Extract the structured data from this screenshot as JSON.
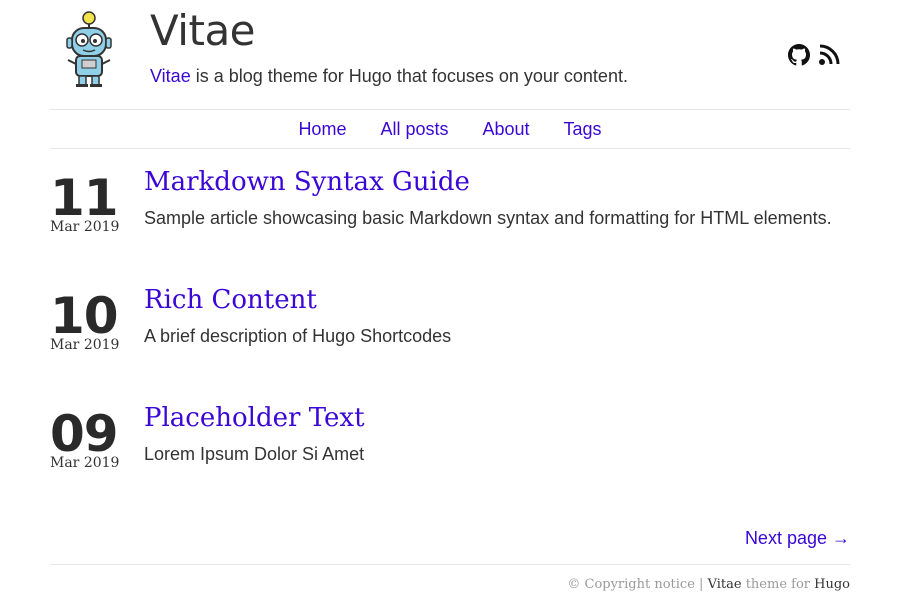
{
  "site": {
    "title": "Vitae",
    "tagline_link": "Vitae",
    "tagline_rest": " is a blog theme for Hugo that focuses on your content."
  },
  "social": [
    {
      "icon": "github-icon"
    },
    {
      "icon": "rss-icon"
    }
  ],
  "nav": [
    {
      "label": "Home"
    },
    {
      "label": "All posts"
    },
    {
      "label": "About"
    },
    {
      "label": "Tags"
    }
  ],
  "posts": [
    {
      "day": "11",
      "month": "Mar 2019",
      "title": "Markdown Syntax Guide",
      "description": "Sample article showcasing basic Markdown syntax and formatting for HTML elements."
    },
    {
      "day": "10",
      "month": "Mar 2019",
      "title": "Rich Content",
      "description": "A brief description of Hugo Shortcodes"
    },
    {
      "day": "09",
      "month": "Mar 2019",
      "title": "Placeholder Text",
      "description": "Lorem Ipsum Dolor Si Amet"
    }
  ],
  "pager": {
    "next_label": "Next page →"
  },
  "footer": {
    "copyright": "© Copyright notice",
    "sep": " | ",
    "theme_name": "Vitae",
    "theme_mid": " theme for ",
    "engine": "Hugo"
  },
  "colors": {
    "link": "#3a07d6",
    "text": "#333333",
    "border": "#e6e6e6",
    "muted": "#9a9a9a"
  }
}
